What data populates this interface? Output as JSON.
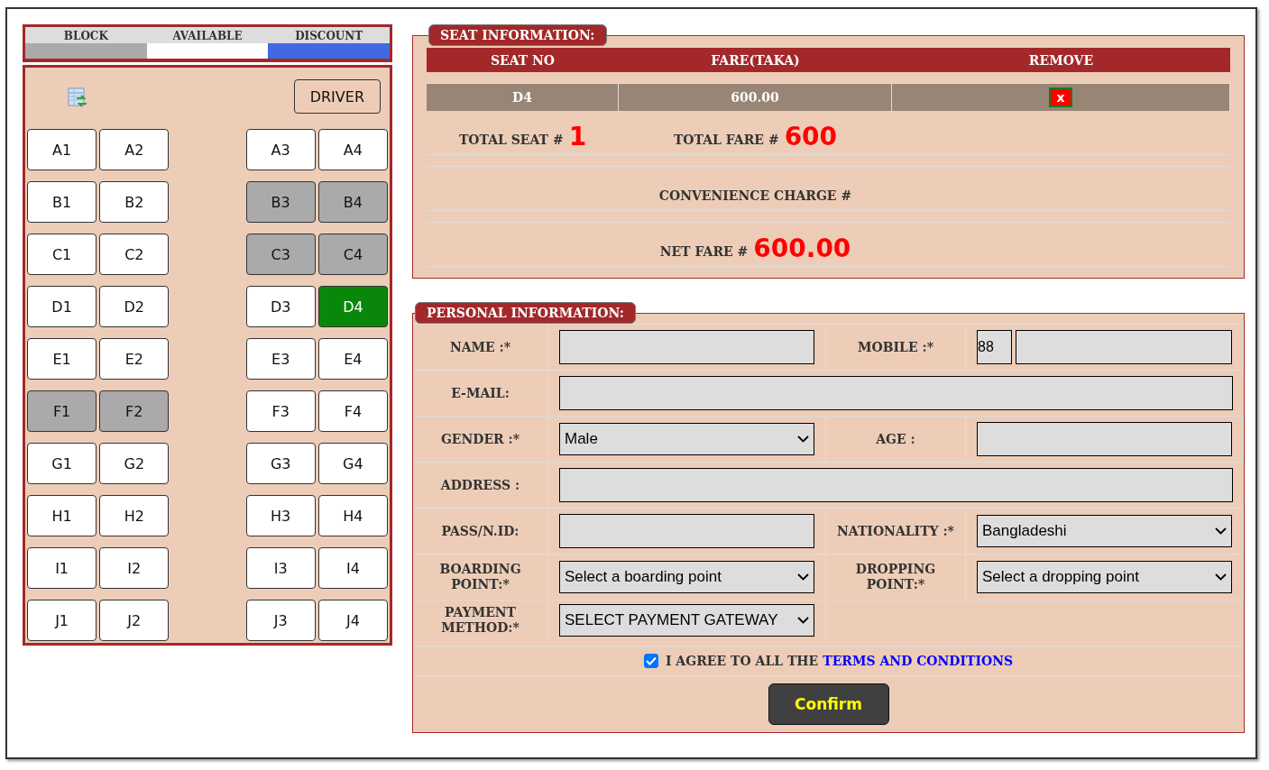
{
  "legend": [
    {
      "label": "BLOCK",
      "color": "#aaaaaa"
    },
    {
      "label": "AVAILABLE",
      "color": "#ffffff"
    },
    {
      "label": "DISCOUNT",
      "color": "#4169e1"
    }
  ],
  "driver_button": "DRIVER",
  "seat_rows": [
    [
      {
        "label": "A1",
        "kind": "available"
      },
      {
        "label": "A2",
        "kind": "available"
      },
      {
        "label": "A3",
        "kind": "available"
      },
      {
        "label": "A4",
        "kind": "available"
      }
    ],
    [
      {
        "label": "B1",
        "kind": "available"
      },
      {
        "label": "B2",
        "kind": "available"
      },
      {
        "label": "B3",
        "kind": "booked"
      },
      {
        "label": "B4",
        "kind": "booked"
      }
    ],
    [
      {
        "label": "C1",
        "kind": "available"
      },
      {
        "label": "C2",
        "kind": "available"
      },
      {
        "label": "C3",
        "kind": "booked"
      },
      {
        "label": "C4",
        "kind": "booked"
      }
    ],
    [
      {
        "label": "D1",
        "kind": "available"
      },
      {
        "label": "D2",
        "kind": "available"
      },
      {
        "label": "D3",
        "kind": "available"
      },
      {
        "label": "D4",
        "kind": "selected"
      }
    ],
    [
      {
        "label": "E1",
        "kind": "available"
      },
      {
        "label": "E2",
        "kind": "available"
      },
      {
        "label": "E3",
        "kind": "available"
      },
      {
        "label": "E4",
        "kind": "available"
      }
    ],
    [
      {
        "label": "F1",
        "kind": "booked"
      },
      {
        "label": "F2",
        "kind": "booked"
      },
      {
        "label": "F3",
        "kind": "available"
      },
      {
        "label": "F4",
        "kind": "available"
      }
    ],
    [
      {
        "label": "G1",
        "kind": "available"
      },
      {
        "label": "G2",
        "kind": "available"
      },
      {
        "label": "G3",
        "kind": "available"
      },
      {
        "label": "G4",
        "kind": "available"
      }
    ],
    [
      {
        "label": "H1",
        "kind": "available"
      },
      {
        "label": "H2",
        "kind": "available"
      },
      {
        "label": "H3",
        "kind": "available"
      },
      {
        "label": "H4",
        "kind": "available"
      }
    ],
    [
      {
        "label": "I1",
        "kind": "available"
      },
      {
        "label": "I2",
        "kind": "available"
      },
      {
        "label": "I3",
        "kind": "available"
      },
      {
        "label": "I4",
        "kind": "available"
      }
    ],
    [
      {
        "label": "J1",
        "kind": "available"
      },
      {
        "label": "J2",
        "kind": "available"
      },
      {
        "label": "J3",
        "kind": "available"
      },
      {
        "label": "J4",
        "kind": "available"
      }
    ]
  ],
  "seat_information": {
    "title": "SEAT INFORMATION:",
    "columns": [
      "SEAT NO",
      "FARE(TAKA)",
      "REMOVE"
    ],
    "rows": [
      {
        "seat": "D4",
        "fare": "600.00",
        "remove": "x"
      }
    ],
    "total_seat_label": "TOTAL SEAT #",
    "total_seat": "1",
    "total_fare_label": "TOTAL FARE #",
    "total_fare": "600",
    "convenience_label": "CONVENIENCE CHARGE #",
    "net_fare_label": "NET FARE #",
    "net_fare": "600.00"
  },
  "personal_information": {
    "title": "PERSONAL INFORMATION:",
    "rows": [
      [
        {
          "kind": "label",
          "text": "NAME :*"
        },
        {
          "kind": "input"
        },
        {
          "kind": "label",
          "text": "MOBILE :*"
        },
        {
          "kind": "phone",
          "prefix": "88"
        }
      ],
      [
        {
          "kind": "label",
          "text": "E-MAIL:"
        },
        {
          "kind": "wide-input"
        }
      ],
      [
        {
          "kind": "label",
          "text": "GENDER :*"
        },
        {
          "kind": "select",
          "value": "Male"
        },
        {
          "kind": "label",
          "text": "AGE :"
        },
        {
          "kind": "input"
        }
      ],
      [
        {
          "kind": "label",
          "text": "ADDRESS :"
        },
        {
          "kind": "wide-input"
        }
      ],
      [
        {
          "kind": "label",
          "text": "PASS/N.ID:"
        },
        {
          "kind": "input"
        },
        {
          "kind": "label",
          "text": "NATIONALITY :*"
        },
        {
          "kind": "select",
          "value": "Bangladeshi"
        }
      ],
      [
        {
          "kind": "label",
          "text": "BOARDING POINT:*"
        },
        {
          "kind": "select",
          "value": "Select a boarding point"
        },
        {
          "kind": "label",
          "text": "DROPPING POINT:*"
        },
        {
          "kind": "select",
          "value": "Select a dropping point"
        }
      ],
      [
        {
          "kind": "label",
          "text": "PAYMENT METHOD:*"
        },
        {
          "kind": "select",
          "value": "SELECT PAYMENT GATEWAY"
        },
        {
          "kind": "empty"
        }
      ]
    ],
    "agree": {
      "checked": true,
      "text": "I AGREE TO ALL THE",
      "link": "TERMS AND CONDITIONS"
    },
    "confirm_button": "Confirm"
  }
}
